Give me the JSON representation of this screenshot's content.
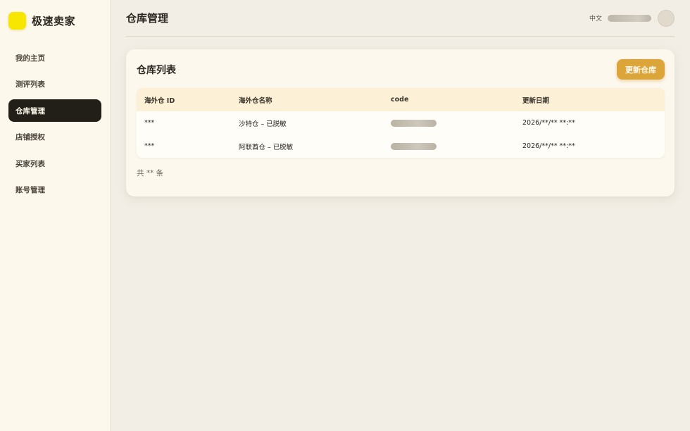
{
  "brand": {
    "name": "极速卖家",
    "logo_color": "#f7e600"
  },
  "sidebar": {
    "items": [
      {
        "label": "我的主页",
        "active": false
      },
      {
        "label": "测评列表",
        "active": false
      },
      {
        "label": "仓库管理",
        "active": true
      },
      {
        "label": "店铺授权",
        "active": false
      },
      {
        "label": "买家列表",
        "active": false
      },
      {
        "label": "账号管理",
        "active": false
      }
    ]
  },
  "header": {
    "title": "仓库管理",
    "language": "中文"
  },
  "card": {
    "title": "仓库列表",
    "update_button": "更新仓库",
    "accent": "#dba53a"
  },
  "table": {
    "columns": [
      "海外仓 ID",
      "海外仓名称",
      "code",
      "更新日期"
    ],
    "rows": [
      {
        "id": "***",
        "name": "沙特仓 – 已脱敏",
        "date": "2026/**/** **:**"
      },
      {
        "id": "***",
        "name": "阿联酋仓 – 已脱敏",
        "date": "2026/**/** **:**"
      }
    ]
  },
  "footer": {
    "total": "共 ** 条"
  }
}
